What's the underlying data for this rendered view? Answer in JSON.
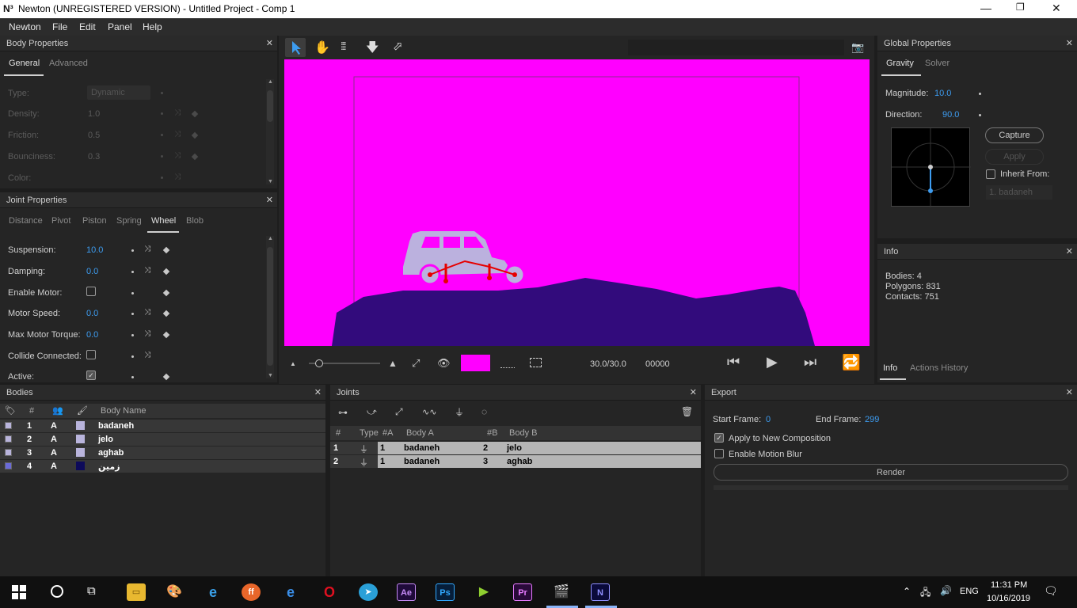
{
  "window": {
    "logo": "N³",
    "title": "Newton (UNREGISTERED VERSION) - Untitled Project - Comp 1"
  },
  "menu": [
    "Newton",
    "File",
    "Edit",
    "Panel",
    "Help"
  ],
  "body_properties": {
    "title": "Body Properties",
    "tabs": [
      "General",
      "Advanced"
    ],
    "rows": [
      {
        "label": "Type:",
        "value": "Dynamic"
      },
      {
        "label": "Density:",
        "value": "1.0"
      },
      {
        "label": "Friction:",
        "value": "0.5"
      },
      {
        "label": "Bounciness:",
        "value": "0.3"
      },
      {
        "label": "Color:",
        "value": ""
      }
    ]
  },
  "joint_properties": {
    "title": "Joint Properties",
    "tabs": [
      "Distance",
      "Pivot",
      "Piston",
      "Spring",
      "Wheel",
      "Blob"
    ],
    "rows": [
      {
        "label": "Suspension:",
        "value": "10.0"
      },
      {
        "label": "Damping:",
        "value": "0.0"
      },
      {
        "label": "Enable Motor:",
        "value": ""
      },
      {
        "label": "Motor Speed:",
        "value": "0.0"
      },
      {
        "label": "Max Motor Torque:",
        "value": "0.0"
      },
      {
        "label": "Collide Connected:",
        "value": ""
      },
      {
        "label": "Active:",
        "value": ""
      }
    ]
  },
  "viewer": {
    "time": "30.0/30.0",
    "frame": "00000",
    "swatch_color": "#ff00ff"
  },
  "global_properties": {
    "title": "Global Properties",
    "tabs": [
      "Gravity",
      "Solver"
    ],
    "magnitude_label": "Magnitude:",
    "magnitude": "10.0",
    "direction_label": "Direction:",
    "direction": "90.0",
    "capture": "Capture",
    "apply": "Apply",
    "inherit_from": "Inherit From:",
    "inherit_value": "1. badaneh"
  },
  "info": {
    "title": "Info",
    "bodies": "Bodies: 4",
    "polygons": "Polygons: 831",
    "contacts": "Contacts: 751",
    "tabs": [
      "Info",
      "Actions History"
    ]
  },
  "bodies_panel": {
    "title": "Bodies",
    "headers": [
      "#",
      "Body Name"
    ],
    "rows": [
      {
        "num": "1",
        "type": "A",
        "name": "badaneh",
        "swatch": "#b9b4dc"
      },
      {
        "num": "2",
        "type": "A",
        "name": "jelo",
        "swatch": "#b9b4dc"
      },
      {
        "num": "3",
        "type": "A",
        "name": "aghab",
        "swatch": "#b9b4dc"
      },
      {
        "num": "4",
        "type": "A",
        "name": "زمین",
        "swatch": "#0d0a5a"
      }
    ]
  },
  "joints_panel": {
    "title": "Joints",
    "headers": [
      "#",
      "Type",
      "#A",
      "Body A",
      "#B",
      "Body B"
    ],
    "rows": [
      {
        "num": "1",
        "a_num": "1",
        "a": "badaneh",
        "b_num": "2",
        "b": "jelo"
      },
      {
        "num": "2",
        "a_num": "1",
        "a": "badaneh",
        "b_num": "3",
        "b": "aghab"
      }
    ]
  },
  "export": {
    "title": "Export",
    "start_label": "Start Frame:",
    "start": "0",
    "end_label": "End Frame:",
    "end": "299",
    "apply_comp": "Apply to New Composition",
    "motion_blur": "Enable Motion Blur",
    "render": "Render"
  },
  "taskbar": {
    "time": "11:31 PM",
    "date": "10/16/2019",
    "lang": "ENG"
  }
}
